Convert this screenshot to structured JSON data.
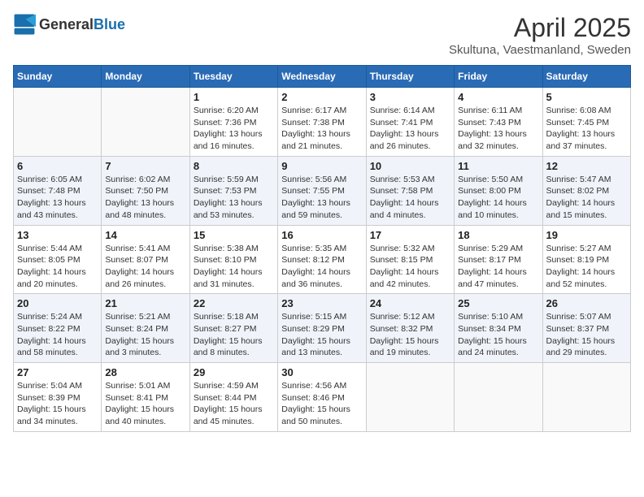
{
  "header": {
    "logo_general": "General",
    "logo_blue": "Blue",
    "title": "April 2025",
    "subtitle": "Skultuna, Vaestmanland, Sweden"
  },
  "calendar": {
    "days_of_week": [
      "Sunday",
      "Monday",
      "Tuesday",
      "Wednesday",
      "Thursday",
      "Friday",
      "Saturday"
    ],
    "weeks": [
      [
        {
          "day": "",
          "info": ""
        },
        {
          "day": "",
          "info": ""
        },
        {
          "day": "1",
          "info": "Sunrise: 6:20 AM\nSunset: 7:36 PM\nDaylight: 13 hours and 16 minutes."
        },
        {
          "day": "2",
          "info": "Sunrise: 6:17 AM\nSunset: 7:38 PM\nDaylight: 13 hours and 21 minutes."
        },
        {
          "day": "3",
          "info": "Sunrise: 6:14 AM\nSunset: 7:41 PM\nDaylight: 13 hours and 26 minutes."
        },
        {
          "day": "4",
          "info": "Sunrise: 6:11 AM\nSunset: 7:43 PM\nDaylight: 13 hours and 32 minutes."
        },
        {
          "day": "5",
          "info": "Sunrise: 6:08 AM\nSunset: 7:45 PM\nDaylight: 13 hours and 37 minutes."
        }
      ],
      [
        {
          "day": "6",
          "info": "Sunrise: 6:05 AM\nSunset: 7:48 PM\nDaylight: 13 hours and 43 minutes."
        },
        {
          "day": "7",
          "info": "Sunrise: 6:02 AM\nSunset: 7:50 PM\nDaylight: 13 hours and 48 minutes."
        },
        {
          "day": "8",
          "info": "Sunrise: 5:59 AM\nSunset: 7:53 PM\nDaylight: 13 hours and 53 minutes."
        },
        {
          "day": "9",
          "info": "Sunrise: 5:56 AM\nSunset: 7:55 PM\nDaylight: 13 hours and 59 minutes."
        },
        {
          "day": "10",
          "info": "Sunrise: 5:53 AM\nSunset: 7:58 PM\nDaylight: 14 hours and 4 minutes."
        },
        {
          "day": "11",
          "info": "Sunrise: 5:50 AM\nSunset: 8:00 PM\nDaylight: 14 hours and 10 minutes."
        },
        {
          "day": "12",
          "info": "Sunrise: 5:47 AM\nSunset: 8:02 PM\nDaylight: 14 hours and 15 minutes."
        }
      ],
      [
        {
          "day": "13",
          "info": "Sunrise: 5:44 AM\nSunset: 8:05 PM\nDaylight: 14 hours and 20 minutes."
        },
        {
          "day": "14",
          "info": "Sunrise: 5:41 AM\nSunset: 8:07 PM\nDaylight: 14 hours and 26 minutes."
        },
        {
          "day": "15",
          "info": "Sunrise: 5:38 AM\nSunset: 8:10 PM\nDaylight: 14 hours and 31 minutes."
        },
        {
          "day": "16",
          "info": "Sunrise: 5:35 AM\nSunset: 8:12 PM\nDaylight: 14 hours and 36 minutes."
        },
        {
          "day": "17",
          "info": "Sunrise: 5:32 AM\nSunset: 8:15 PM\nDaylight: 14 hours and 42 minutes."
        },
        {
          "day": "18",
          "info": "Sunrise: 5:29 AM\nSunset: 8:17 PM\nDaylight: 14 hours and 47 minutes."
        },
        {
          "day": "19",
          "info": "Sunrise: 5:27 AM\nSunset: 8:19 PM\nDaylight: 14 hours and 52 minutes."
        }
      ],
      [
        {
          "day": "20",
          "info": "Sunrise: 5:24 AM\nSunset: 8:22 PM\nDaylight: 14 hours and 58 minutes."
        },
        {
          "day": "21",
          "info": "Sunrise: 5:21 AM\nSunset: 8:24 PM\nDaylight: 15 hours and 3 minutes."
        },
        {
          "day": "22",
          "info": "Sunrise: 5:18 AM\nSunset: 8:27 PM\nDaylight: 15 hours and 8 minutes."
        },
        {
          "day": "23",
          "info": "Sunrise: 5:15 AM\nSunset: 8:29 PM\nDaylight: 15 hours and 13 minutes."
        },
        {
          "day": "24",
          "info": "Sunrise: 5:12 AM\nSunset: 8:32 PM\nDaylight: 15 hours and 19 minutes."
        },
        {
          "day": "25",
          "info": "Sunrise: 5:10 AM\nSunset: 8:34 PM\nDaylight: 15 hours and 24 minutes."
        },
        {
          "day": "26",
          "info": "Sunrise: 5:07 AM\nSunset: 8:37 PM\nDaylight: 15 hours and 29 minutes."
        }
      ],
      [
        {
          "day": "27",
          "info": "Sunrise: 5:04 AM\nSunset: 8:39 PM\nDaylight: 15 hours and 34 minutes."
        },
        {
          "day": "28",
          "info": "Sunrise: 5:01 AM\nSunset: 8:41 PM\nDaylight: 15 hours and 40 minutes."
        },
        {
          "day": "29",
          "info": "Sunrise: 4:59 AM\nSunset: 8:44 PM\nDaylight: 15 hours and 45 minutes."
        },
        {
          "day": "30",
          "info": "Sunrise: 4:56 AM\nSunset: 8:46 PM\nDaylight: 15 hours and 50 minutes."
        },
        {
          "day": "",
          "info": ""
        },
        {
          "day": "",
          "info": ""
        },
        {
          "day": "",
          "info": ""
        }
      ]
    ]
  }
}
